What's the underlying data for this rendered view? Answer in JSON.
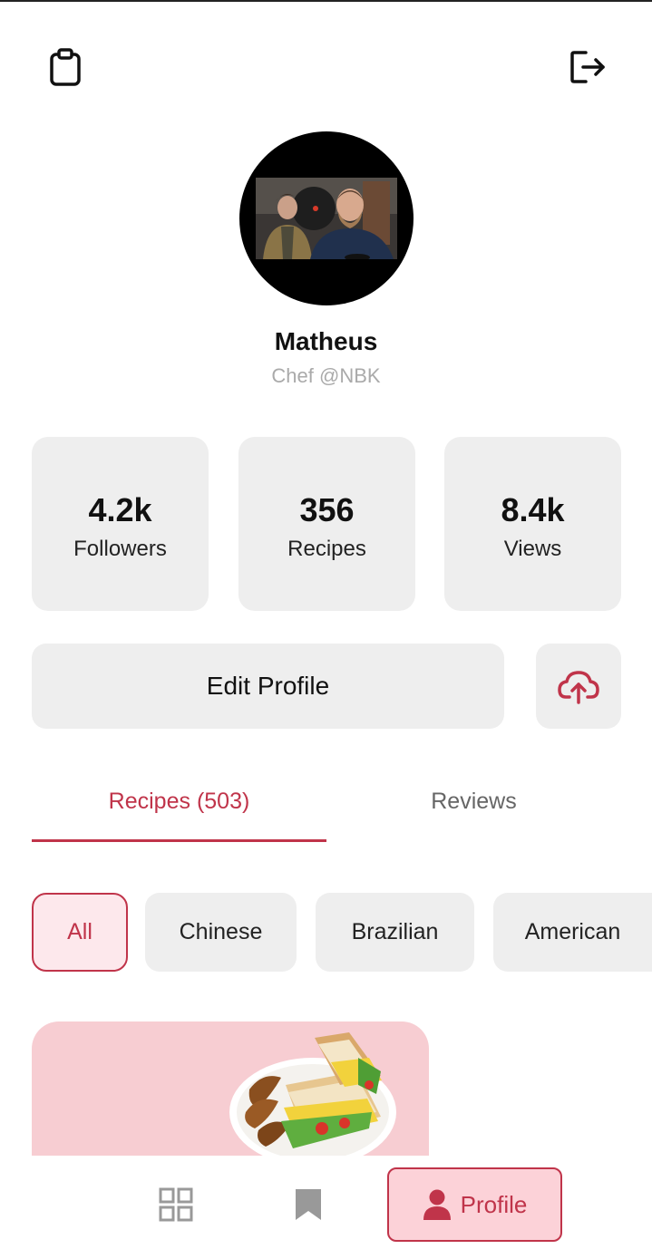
{
  "profile": {
    "name": "Matheus",
    "role": "Chef @NBK"
  },
  "stats": [
    {
      "value": "4.2k",
      "label": "Followers"
    },
    {
      "value": "356",
      "label": "Recipes"
    },
    {
      "value": "8.4k",
      "label": "Views"
    }
  ],
  "actions": {
    "edit_label": "Edit Profile"
  },
  "tabs": [
    {
      "label": "Recipes (503)",
      "active": true
    },
    {
      "label": "Reviews",
      "active": false
    }
  ],
  "categories": [
    {
      "label": "All",
      "active": true
    },
    {
      "label": "Chinese",
      "active": false
    },
    {
      "label": "Brazilian",
      "active": false
    },
    {
      "label": "American",
      "active": false
    }
  ],
  "bottom_nav": {
    "profile_label": "Profile"
  },
  "colors": {
    "accent": "#c0344a",
    "surface": "#eeeeee",
    "card_pink": "#f7cdd2"
  },
  "icons": {
    "top_left": "clipboard-icon",
    "top_right": "logout-icon",
    "upload": "cloud-upload-icon",
    "nav": [
      "grid-icon",
      "bookmark-icon",
      "person-icon"
    ]
  }
}
